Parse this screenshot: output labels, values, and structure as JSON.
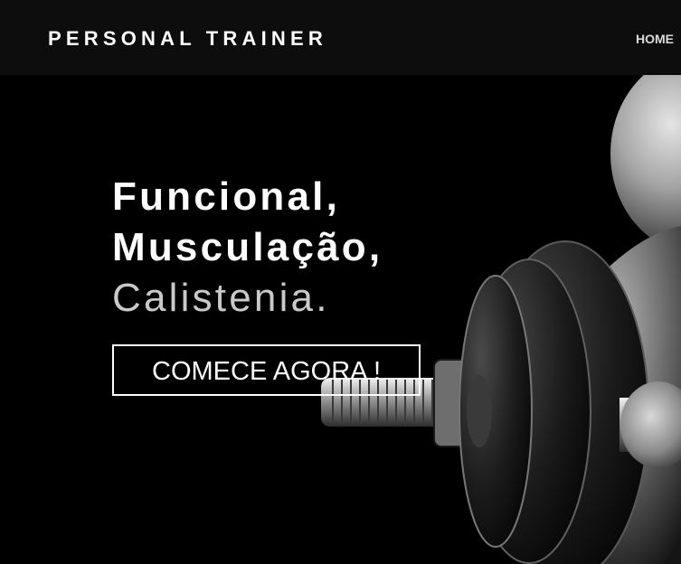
{
  "header": {
    "brand": "PERSONAL TRAINER",
    "nav": [
      {
        "label": "HOME"
      }
    ]
  },
  "hero": {
    "headline": {
      "line1": "Funcional,",
      "line2": "Musculação,",
      "line3": "Calistenia."
    },
    "cta_label": "COMECE AGORA !",
    "image": "dumbbell-photo"
  },
  "colors": {
    "background": "#000000",
    "header_background": "#0d0d0d",
    "text": "#ffffff",
    "muted_text": "#c9c9c9"
  }
}
